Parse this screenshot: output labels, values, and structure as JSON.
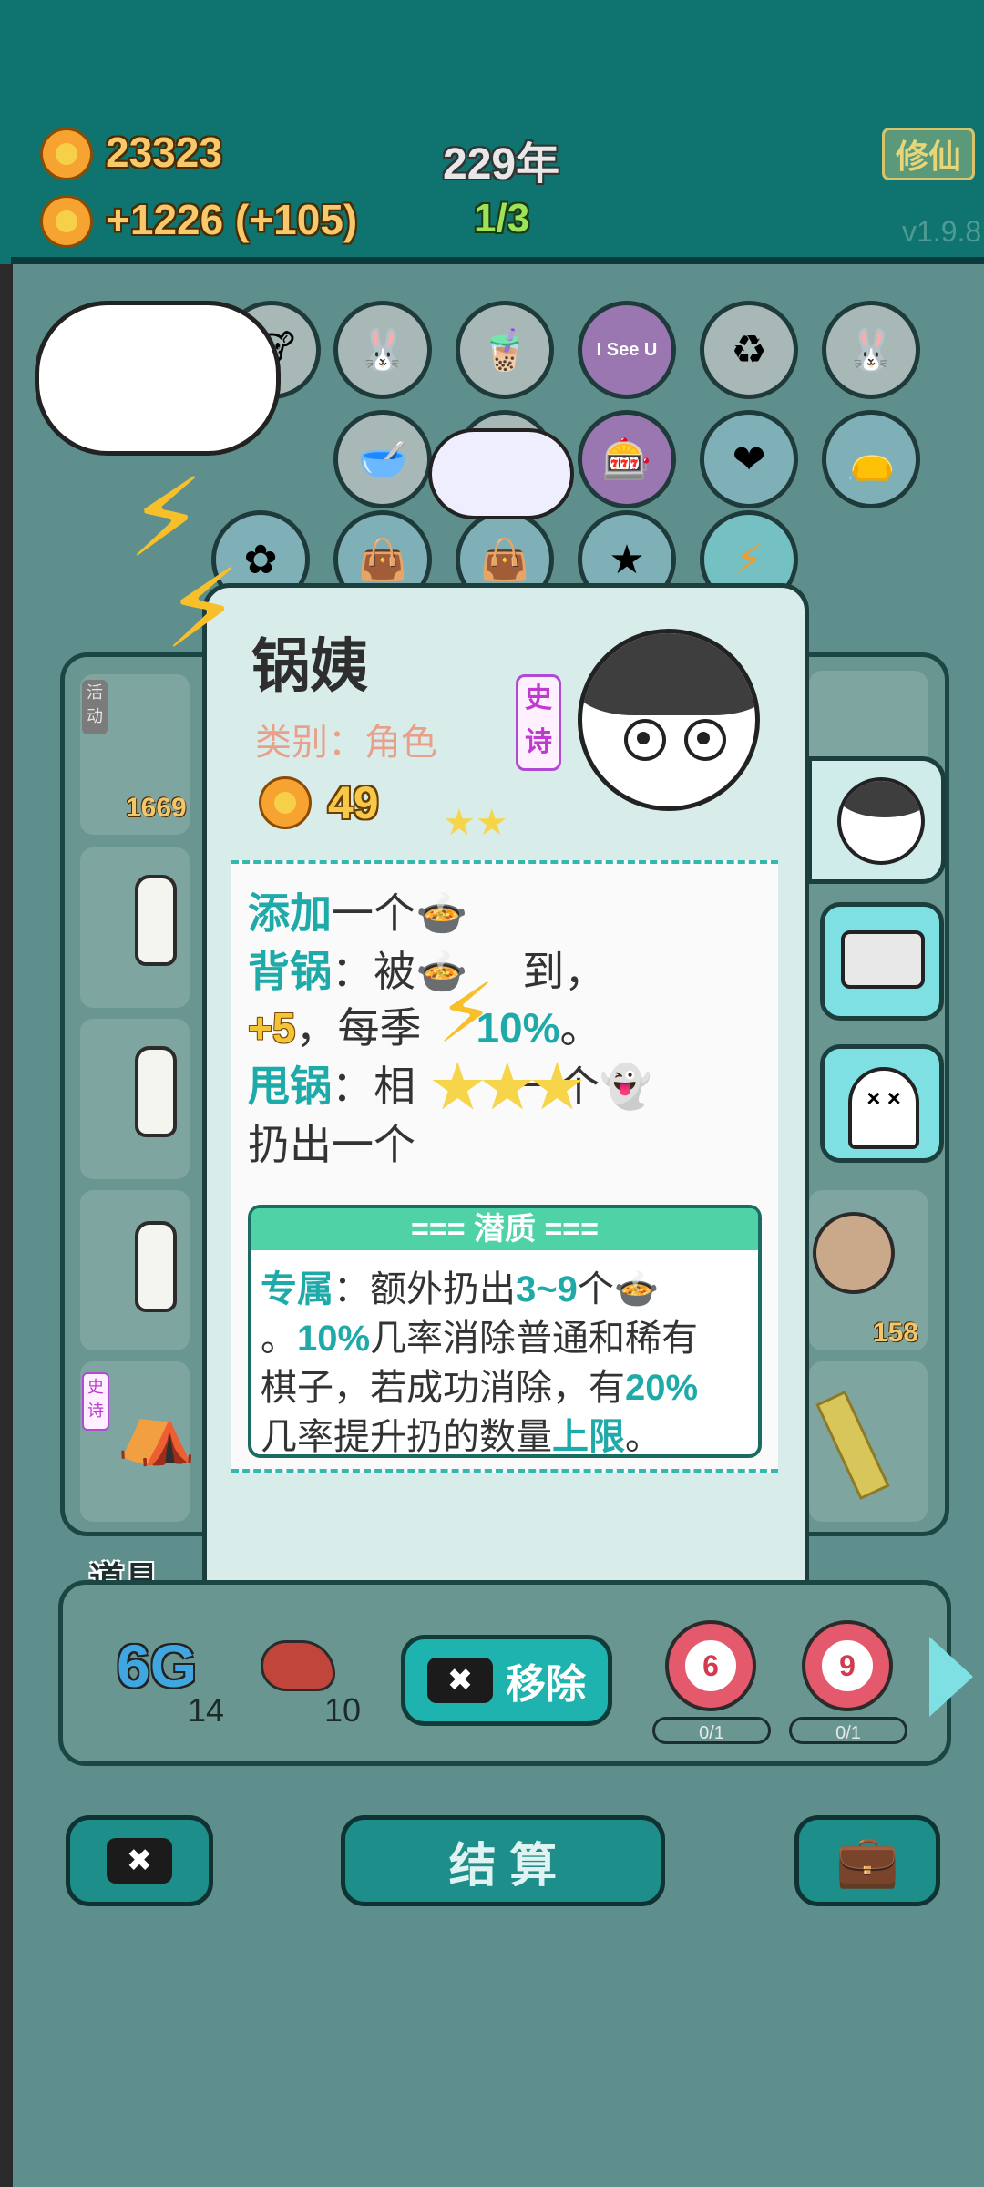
{
  "header": {
    "coins": "23323",
    "income": "+1226 (+105)",
    "year": "229年",
    "wave": "1/3",
    "cultivate_label": "修仙",
    "version": "v1.9.8"
  },
  "board": {
    "activity_tag": "活动",
    "left_count": "1669",
    "right_count": "158",
    "epic_tag": "史诗",
    "isee_label": "I See U"
  },
  "popup": {
    "name": "锅姨",
    "category": "类别：角色",
    "cost": "49",
    "rarity": "史诗",
    "line1_kw": "添加",
    "line1_rest": "一个",
    "line2_kw": "背锅",
    "line2_rest": "：被",
    "line2_tail": "到，",
    "line3_kw": "+5",
    "line3_rest": "，每季",
    "line3_pct": "10%",
    "line3_tail": "。",
    "line4_kw": "甩锅",
    "line4_rest": "：相",
    "line4_tail": "一个",
    "line5": "扔出一个",
    "trait_title": "=== 潜质 ===",
    "trait1_kw": "专属",
    "trait1_rest": "：额外扔出",
    "trait1_range": "3~9",
    "trait1_tail": "个",
    "trait2_pct": "10%",
    "trait2_rest": "几率消除普通和稀有",
    "trait2_lead": "。",
    "trait3_rest": "棋子，若成功消除，有",
    "trait3_pct": "20%",
    "trait4_rest": "几率提升扔的数量",
    "trait4_kw": "上限",
    "trait4_tail": "。"
  },
  "items": {
    "label": "道具",
    "item1_name": "6G",
    "item1_count": "14",
    "item2_count": "10",
    "target1": "6",
    "target1_count": "0/1",
    "target2": "9",
    "target2_count": "0/1",
    "remove_label": "移除"
  },
  "footer": {
    "settle_label": "结 算"
  }
}
